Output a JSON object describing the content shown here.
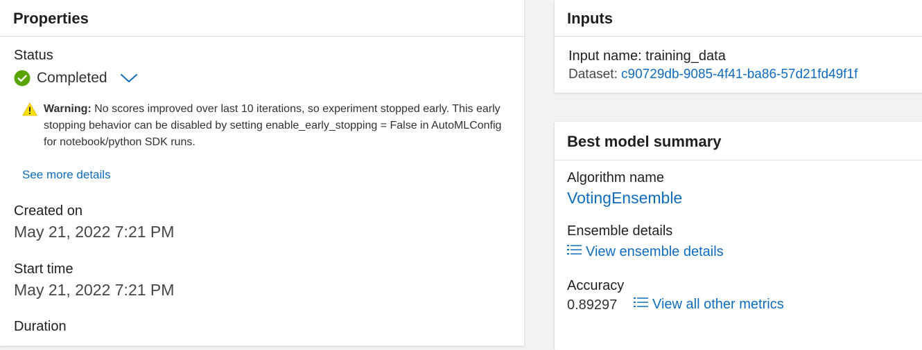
{
  "properties": {
    "title": "Properties",
    "status_label": "Status",
    "status_value": "Completed",
    "warning_prefix": "Warning:",
    "warning_text": " No scores improved over last 10 iterations, so experiment stopped early. This early stopping behavior can be disabled by setting enable_early_stopping = False in AutoMLConfig for notebook/python SDK runs.",
    "see_more": "See more details",
    "created_label": "Created on",
    "created_value": "May 21, 2022 7:21 PM",
    "start_label": "Start time",
    "start_value": "May 21, 2022 7:21 PM",
    "duration_label": "Duration"
  },
  "inputs": {
    "title": "Inputs",
    "input_name": "Input name: training_data",
    "dataset_label": "Dataset: ",
    "dataset_link": "c90729db-9085-4f41-ba86-57d21fd49f1f"
  },
  "best_model": {
    "title": "Best model summary",
    "algorithm_label": "Algorithm name",
    "algorithm_value": "VotingEnsemble",
    "ensemble_label": "Ensemble details",
    "ensemble_link": "View ensemble details",
    "accuracy_label": "Accuracy",
    "accuracy_value": "0.89297",
    "metrics_link": "View all other metrics"
  },
  "colors": {
    "accent_link": "#0f6cbd",
    "success_green": "#57a300",
    "warning_yellow": "#fce100"
  },
  "icons": [
    "checkmark-circle-icon",
    "chevron-down-icon",
    "warning-triangle-icon",
    "bulleted-list-icon"
  ]
}
